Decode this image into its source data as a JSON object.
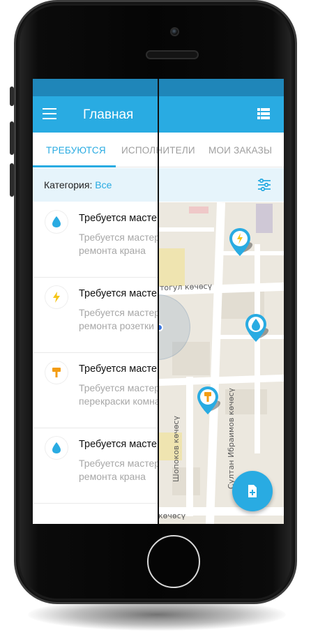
{
  "app_bar": {
    "title": "Главная"
  },
  "tabs": [
    {
      "label": "ТРЕБУЮТСЯ",
      "active": true
    },
    {
      "label": "ИСПОЛНИТЕЛИ",
      "active": false
    },
    {
      "label": "МОИ ЗАКАЗЫ",
      "active": false
    }
  ],
  "category": {
    "label": "Категория:",
    "value": "Все"
  },
  "list": [
    {
      "icon": "water-drop-icon",
      "title": "Требуется мастер",
      "desc_line1": "Требуется мастер для",
      "desc_line2": "ремонта крана"
    },
    {
      "icon": "lightning-icon",
      "title": "Требуется мастер",
      "desc_line1": "Требуется мастер для",
      "desc_line2": "ремонта розетки"
    },
    {
      "icon": "paint-brush-icon",
      "title": "Требуется мастер",
      "desc_line1": "Требуется мастер для",
      "desc_line2": "перекраски комнаты"
    },
    {
      "icon": "water-drop-icon",
      "title": "Требуется мастер",
      "desc_line1": "Требуется мастер для",
      "desc_line2": "ремонта крана"
    }
  ],
  "map": {
    "streets": [
      "тогул көчөсү",
      "Шопоков көчөсү",
      "Султан Ибраимов көчөсү",
      "көчөсү"
    ],
    "pins": [
      "lightning-pin-icon",
      "water-drop-pin-icon",
      "paint-brush-pin-icon"
    ]
  },
  "colors": {
    "accent": "#29abe2",
    "status_bar": "#1f86b9",
    "category_bg": "#e6f4fb",
    "map_bg": "#ece8df"
  }
}
